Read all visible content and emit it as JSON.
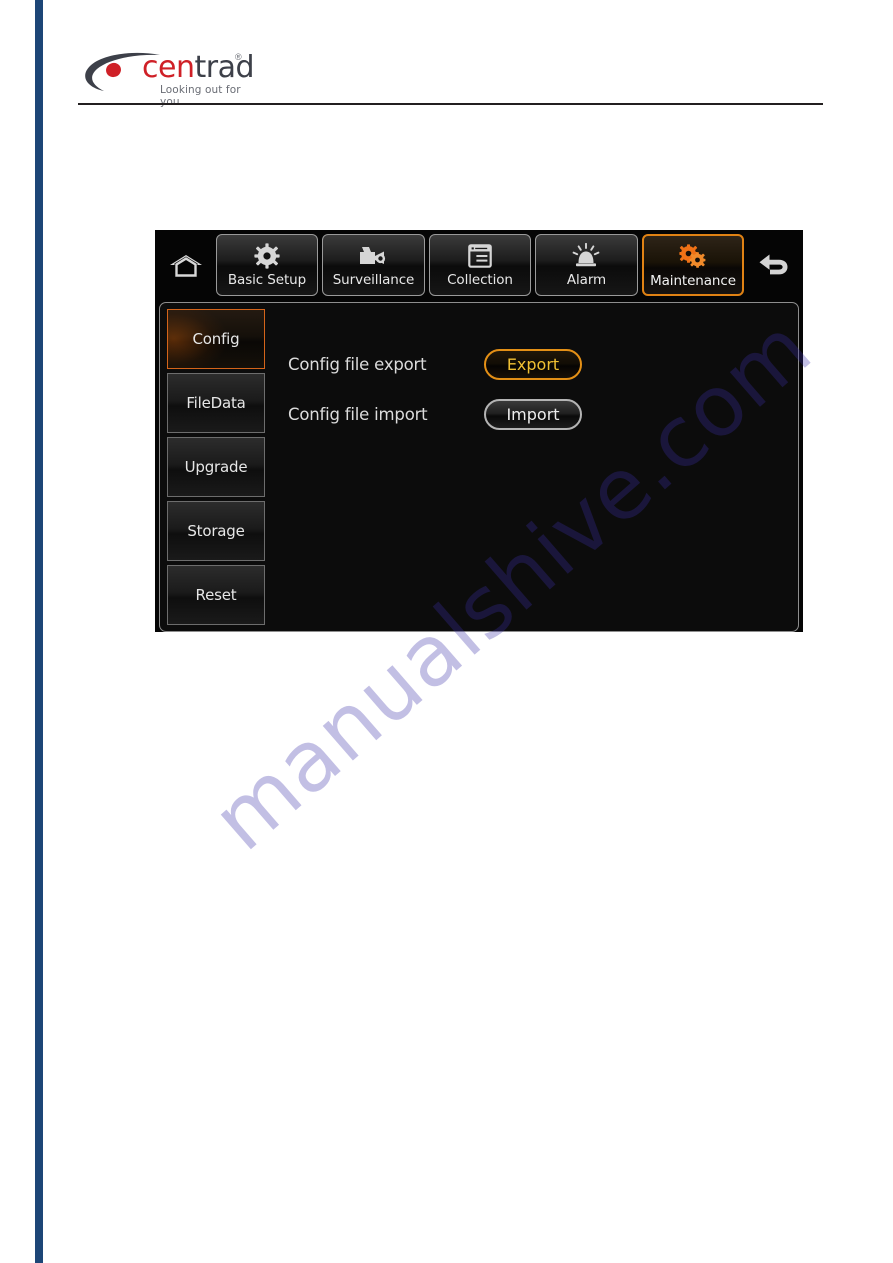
{
  "document": {
    "logo": {
      "name": "centrad",
      "word_part_1": "cen",
      "word_part_2": "trad",
      "registered_mark": "®",
      "tagline": "Looking out for you",
      "brand_red": "#cf2027",
      "brand_dark": "#3d4049"
    },
    "spine_color": "#1d4677",
    "watermark": "manualshive.com"
  },
  "device_ui": {
    "toolbar": {
      "home_icon": "home-icon",
      "back_icon": "back-arrow-icon",
      "tabs": [
        {
          "label": "Basic Setup",
          "icon": "gear-icon",
          "active": false
        },
        {
          "label": "Surveillance",
          "icon": "camera-icon",
          "active": false
        },
        {
          "label": "Collection",
          "icon": "window-icon",
          "active": false
        },
        {
          "label": "Alarm",
          "icon": "siren-icon",
          "active": false
        },
        {
          "label": "Maintenance",
          "icon": "gears-icon",
          "active": true
        }
      ],
      "active_color": "#e08214"
    },
    "side_menu": {
      "items": [
        {
          "label": "Config",
          "active": true
        },
        {
          "label": "FileData",
          "active": false
        },
        {
          "label": "Upgrade",
          "active": false
        },
        {
          "label": "Storage",
          "active": false
        },
        {
          "label": "Reset",
          "active": false
        }
      ],
      "active_color": "#d4641a"
    },
    "content": {
      "rows": [
        {
          "label": "Config file export",
          "button": "Export",
          "style": "export"
        },
        {
          "label": "Config file import",
          "button": "Import",
          "style": "import"
        }
      ],
      "export_text_color": "#f0c033",
      "import_text_color": "#ededed"
    }
  }
}
